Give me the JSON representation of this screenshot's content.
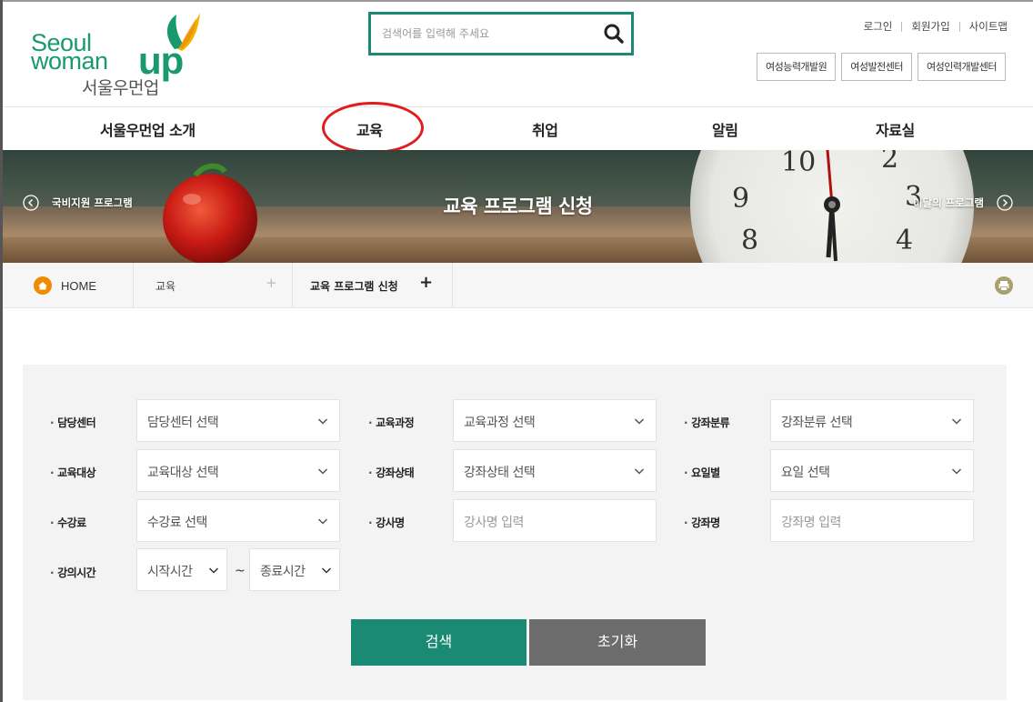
{
  "header": {
    "logo": {
      "line1": "Seoul",
      "line2": "woman",
      "up": "up",
      "korean": "서울우먼업"
    },
    "search": {
      "placeholder": "검색어를 입력해 주세요"
    },
    "util_links": [
      "로그인",
      "회원가입",
      "사이트맵"
    ],
    "shortcuts": [
      "여성능력개발원",
      "여성발전센터",
      "여성인력개발센터"
    ]
  },
  "nav": {
    "items": [
      "서울우먼업 소개",
      "교육",
      "취업",
      "알림",
      "자료실"
    ],
    "highlighted": "교육",
    "highlight_color": "#e01d1d"
  },
  "banner": {
    "title": "교육 프로그램 신청",
    "prev_label": "국비지원 프로그램",
    "next_label": "이달의 프로그램",
    "clock_numbers": [
      "10",
      "9",
      "8",
      "2",
      "3",
      "4"
    ]
  },
  "breadcrumb": {
    "home": "HOME",
    "level1": "교육",
    "current": "교육 프로그램 신청",
    "plus": "+"
  },
  "filters": {
    "center": {
      "label": "담당센터",
      "value": "담당센터 선택"
    },
    "course": {
      "label": "교육과정",
      "value": "교육과정 선택"
    },
    "category": {
      "label": "강좌분류",
      "value": "강좌분류 선택"
    },
    "target": {
      "label": "교육대상",
      "value": "교육대상 선택"
    },
    "status": {
      "label": "강좌상태",
      "value": "강좌상태 선택"
    },
    "weekday": {
      "label": "요일별",
      "value": "요일 선택"
    },
    "fee": {
      "label": "수강료",
      "value": "수강료 선택"
    },
    "instructor": {
      "label": "강사명",
      "placeholder": "강사명 입력"
    },
    "lecture": {
      "label": "강좌명",
      "placeholder": "강좌명 입력"
    },
    "time": {
      "label": "강의시간",
      "start": "시작시간",
      "separator": "~",
      "end": "종료시간"
    }
  },
  "buttons": {
    "search": "검색",
    "reset": "초기화"
  },
  "colors": {
    "brand": "#1a8a74",
    "logo_green": "#1a9a6c",
    "reset_gray": "#6c6c6c",
    "panel_bg": "#f3f3f3"
  }
}
